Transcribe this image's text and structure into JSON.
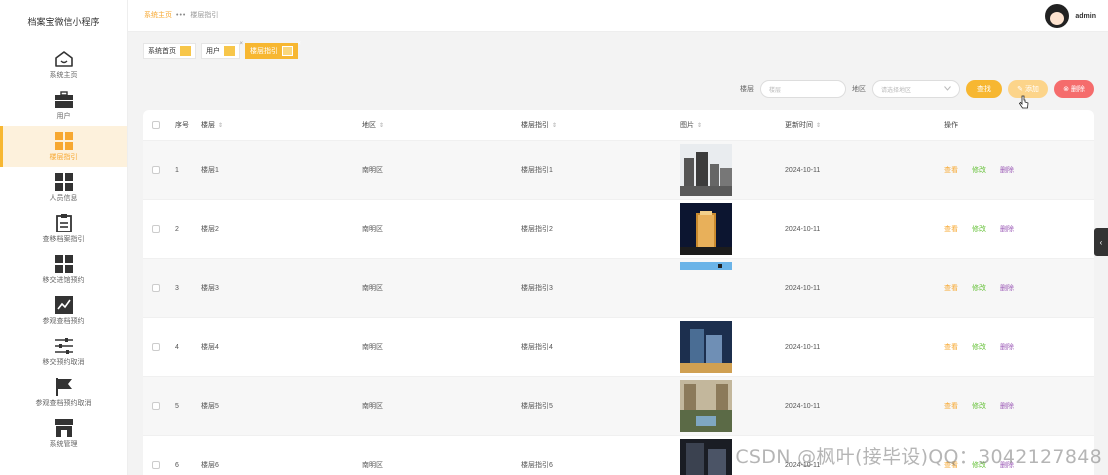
{
  "app": {
    "title": "档案宝微信小程序"
  },
  "sidebar": {
    "items": [
      {
        "label": "系统主页",
        "icon": "home-icon"
      },
      {
        "label": "用户",
        "icon": "briefcase-icon"
      },
      {
        "label": "楼层指引",
        "icon": "grid-icon",
        "active": true
      },
      {
        "label": "人员信息",
        "icon": "grid-icon"
      },
      {
        "label": "查移档案指引",
        "icon": "clipboard-icon"
      },
      {
        "label": "移交进馆预约",
        "icon": "grid-icon"
      },
      {
        "label": "参观查档预约",
        "icon": "chart-icon"
      },
      {
        "label": "移交预约取消",
        "icon": "sliders-icon"
      },
      {
        "label": "参观查档预约取消",
        "icon": "flag-icon"
      },
      {
        "label": "系统管理",
        "icon": "store-icon"
      }
    ]
  },
  "header": {
    "breadcrumb_home": "系统主页",
    "breadcrumb_current": "楼层指引",
    "username": "admin"
  },
  "tabs": [
    {
      "label": "系统首页"
    },
    {
      "label": "用户"
    },
    {
      "label": "楼层指引",
      "active": true
    }
  ],
  "search": {
    "floor_label": "楼层",
    "floor_placeholder": "楼层",
    "region_label": "地区",
    "region_placeholder": "请选择地区",
    "find_button": "查找",
    "add_button": "添加",
    "delete_button": "删除"
  },
  "table": {
    "headers": {
      "index": "序号",
      "floor": "楼层",
      "region": "地区",
      "guide": "楼层指引",
      "image": "图片",
      "updated": "更新时间",
      "ops": "操作"
    },
    "op_labels": {
      "view": "查看",
      "edit": "修改",
      "delete": "删除"
    },
    "rows": [
      {
        "index": "1",
        "floor": "楼层1",
        "region": "南明区",
        "guide": "楼层指引1",
        "updated": "2024-10-11",
        "image": "city-day"
      },
      {
        "index": "2",
        "floor": "楼层2",
        "region": "南明区",
        "guide": "楼层指引2",
        "updated": "2024-10-11",
        "image": "tower-night"
      },
      {
        "index": "3",
        "floor": "楼层3",
        "region": "南明区",
        "guide": "楼层指引3",
        "updated": "2024-10-11",
        "image": "sky-strip"
      },
      {
        "index": "4",
        "floor": "楼层4",
        "region": "南明区",
        "guide": "楼层指引4",
        "updated": "2024-10-11",
        "image": "tower-blue"
      },
      {
        "index": "5",
        "floor": "楼层5",
        "region": "南明区",
        "guide": "楼层指引5",
        "updated": "2024-10-11",
        "image": "plaza"
      },
      {
        "index": "6",
        "floor": "楼层6",
        "region": "南明区",
        "guide": "楼层指引6",
        "updated": "2024-10-11",
        "image": "tower-dark"
      }
    ]
  },
  "watermark": "CSDN @枫叶(接毕设)QQ：3042127848",
  "colors": {
    "accent": "#f7b731",
    "danger": "#f56c6c",
    "edit": "#67c23a",
    "delete_link": "#9b59b6"
  }
}
